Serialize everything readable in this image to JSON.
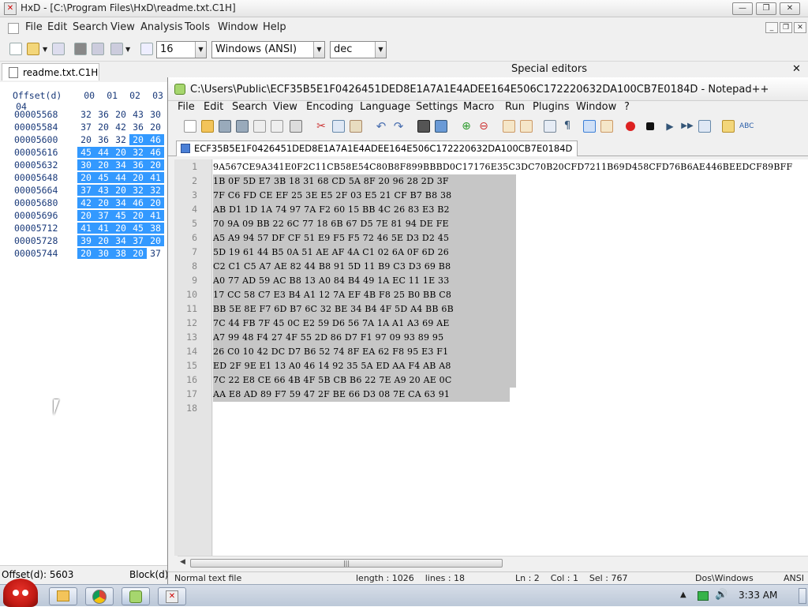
{
  "hxd": {
    "title": "HxD - [C:\\Program Files\\HxD\\readme.txt.C1H]",
    "menu": [
      "File",
      "Edit",
      "Search",
      "View",
      "Analysis",
      "Tools",
      "Window",
      "Help"
    ],
    "bytes_per_row": "16",
    "charset": "Windows (ANSI)",
    "offset_base": "dec",
    "tab_label": "readme.txt.C1H",
    "special_editors": "Special editors",
    "header_offset": "Offset(d)",
    "header_cols": [
      "00",
      "01",
      "02",
      "03",
      "04"
    ],
    "rows": [
      {
        "offset": "00005568",
        "bytes": [
          "32",
          "36",
          "20",
          "43",
          "30"
        ],
        "sel_from": 99
      },
      {
        "offset": "00005584",
        "bytes": [
          "37",
          "20",
          "42",
          "36",
          "20"
        ],
        "sel_from": 99
      },
      {
        "offset": "00005600",
        "bytes": [
          "20",
          "36",
          "32",
          "20",
          "46"
        ],
        "sel_from": 3
      },
      {
        "offset": "00005616",
        "bytes": [
          "45",
          "44",
          "20",
          "32",
          "46"
        ],
        "sel_from": 0
      },
      {
        "offset": "00005632",
        "bytes": [
          "30",
          "20",
          "34",
          "36",
          "20"
        ],
        "sel_from": 0
      },
      {
        "offset": "00005648",
        "bytes": [
          "20",
          "45",
          "44",
          "20",
          "41"
        ],
        "sel_from": 0
      },
      {
        "offset": "00005664",
        "bytes": [
          "37",
          "43",
          "20",
          "32",
          "32"
        ],
        "sel_from": 0
      },
      {
        "offset": "00005680",
        "bytes": [
          "42",
          "20",
          "34",
          "46",
          "20"
        ],
        "sel_from": 0
      },
      {
        "offset": "00005696",
        "bytes": [
          "20",
          "37",
          "45",
          "20",
          "41"
        ],
        "sel_from": 0
      },
      {
        "offset": "00005712",
        "bytes": [
          "41",
          "41",
          "20",
          "45",
          "38"
        ],
        "sel_from": 0
      },
      {
        "offset": "00005728",
        "bytes": [
          "39",
          "20",
          "34",
          "37",
          "20"
        ],
        "sel_from": 0
      },
      {
        "offset": "00005744",
        "bytes": [
          "20",
          "30",
          "38",
          "20",
          "37"
        ],
        "sel_from": 0,
        "sel_to": 3
      }
    ],
    "status_offset": "Offset(d): 5603",
    "status_block": "Block(d)"
  },
  "npp": {
    "title": "C:\\Users\\Public\\ECF35B5E1F0426451DED8E1A7A1E4ADEE164E506C172220632DA100CB7E0184D - Notepad++",
    "menu": [
      "File",
      "Edit",
      "Search",
      "View",
      "Encoding",
      "Language",
      "Settings",
      "Macro",
      "Run",
      "Plugins",
      "Window",
      "?"
    ],
    "tab_label": "ECF35B5E1F0426451DED8E1A7A1E4ADEE164E506C172220632DA100CB7E0184D",
    "lines": [
      "9A567CE9A341E0F2C11CB58E54C80B8F899BBBD0C17176E35C3DC70B20CFD7211B69D458CFD76B6AE446BEEDCF89BFF",
      "1B 0F 5D E7 3B 18 31 68 CD 5A 8F 20 96 28 2D 3F",
      "7F C6 FD CE EF 25 3E E5 2F 03 E5 21 CF B7 B8 38",
      "AB D1 1D 1A 74 97 7A F2 60 15 BB 4C 26 83 E3 B2",
      "70 9A 09 BB 22 6C 77 18 6B 67 D5 7E 81 94 DE FE",
      "A5 A9 94 57 DF CF 51 E9 F5 F5 72 46 5E D3 D2 45",
      "5D 19 61 44 B5 0A 51 AE AF 4A C1 02 6A 0F 6D 26",
      "C2 C1 C5 A7 AE 82 44 B8 91 5D 11 B9 C3 D3 69 B8",
      "A0 77 AD 59 AC B8 13 A0 84 B4 49 1A EC 11 1E 33",
      "17 CC 58 C7 E3 B4 A1 12 7A EF 4B F8 25 B0 BB C8",
      "BB 5E 8E F7 6D B7 6C 32 BE 34 B4 4F 5D A4 BB 6B",
      "7C 44 FB 7F 45 0C E2 59 D6 56 7A 1A A1 A3 69 AE",
      "A7 99 48 F4 27 4F 55 2D 86 D7 F1 97 09 93 89 95",
      "26 C0 10 42 DC D7 B6 52 74 8F EA 62 F8 95 E3 F1",
      "ED 2F 9E E1 13 A0 46 14 92 35 5A ED AA F4 AB A8",
      "7C 22 E8 CE 66 4B 4F 5B CB B6 22 7E A9 20 AE 0C",
      "AA E8 AD 89 F7 59 47 2F BE 66 D3 08 7E CA 63 91",
      ""
    ],
    "status_left": "Normal text file",
    "status_length": "length : 1026    lines : 18",
    "status_pos": "Ln : 2    Col : 1    Sel : 767",
    "status_eol": "Dos\\Windows",
    "status_enc": "ANSI"
  },
  "taskbar": {
    "clock": "3:33 AM"
  }
}
